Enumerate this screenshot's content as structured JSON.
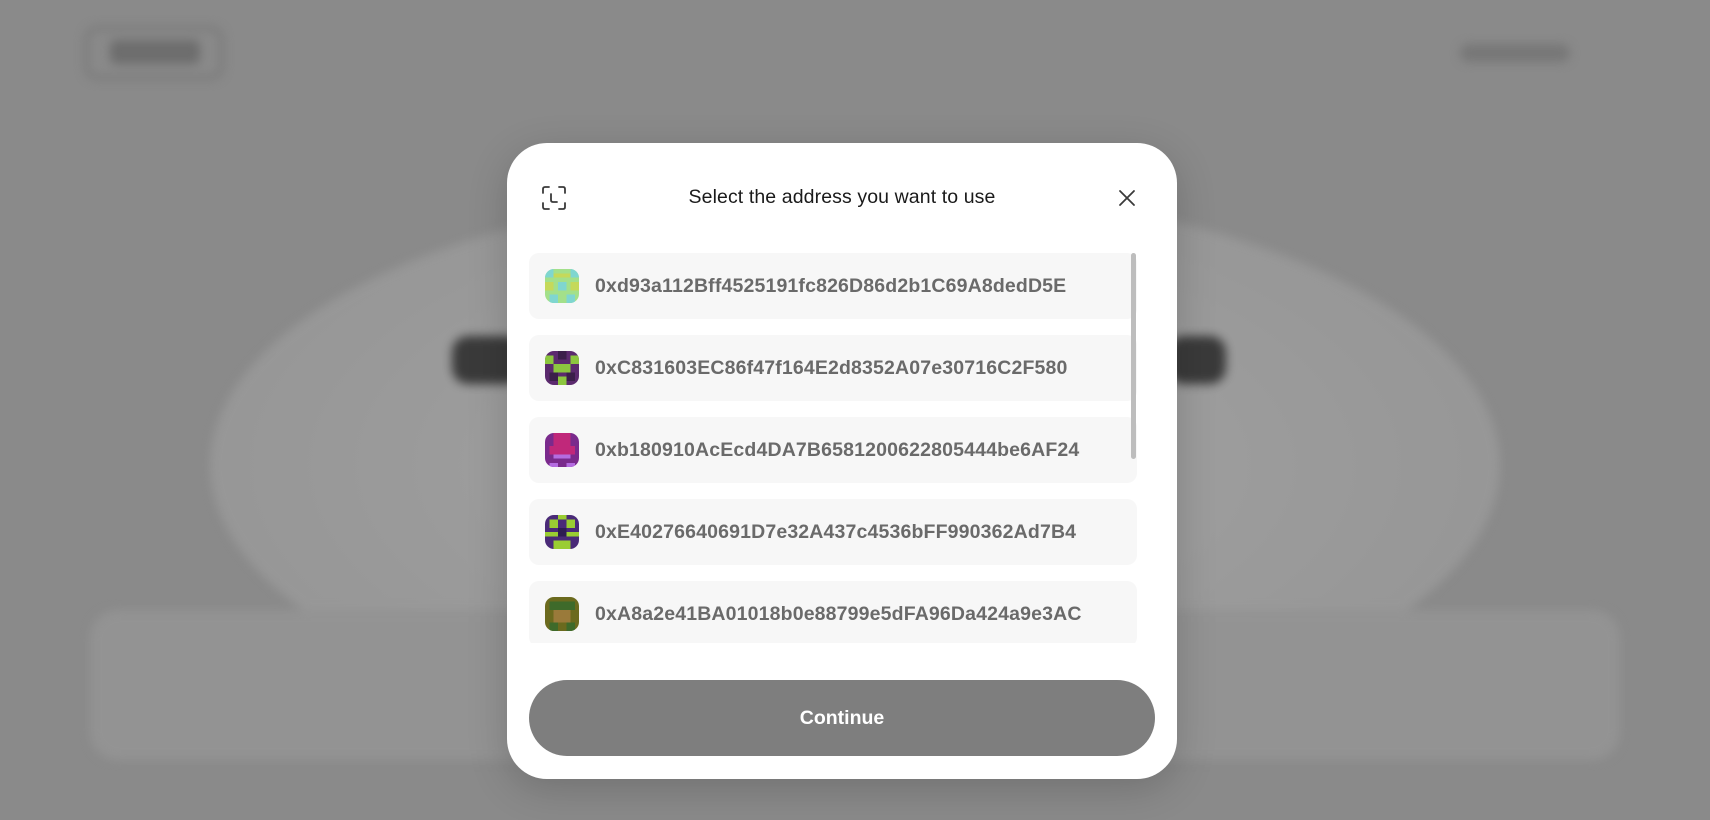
{
  "modal": {
    "title": "Select the address you want to use",
    "continue_label": "Continue",
    "icons": {
      "scan": "scan-qr-icon",
      "close": "close-icon"
    }
  },
  "addresses": [
    {
      "address": "0xd93a112Bff4525191fc826D86d2b1C69A8dedD5E",
      "avatar_colors": [
        "#7fd6d0",
        "#c5d95a",
        "#a3e08a"
      ]
    },
    {
      "address": "0xC831603EC86f47f164E2d8352A07e30716C2F580",
      "avatar_colors": [
        "#5b2a6e",
        "#8cc63f",
        "#3b1f4a"
      ]
    },
    {
      "address": "0xb180910AcEcd4DA7B6581200622805444be6AF24",
      "avatar_colors": [
        "#7a2a8c",
        "#c0287a",
        "#b46ce0"
      ]
    },
    {
      "address": "0xE40276640691D7e32A437c4536bFF990362Ad7B4",
      "avatar_colors": [
        "#4a2a78",
        "#9acd32",
        "#2e1c52"
      ]
    },
    {
      "address": "0xA8a2e41BA01018b0e88799e5dFA96Da424a9e3AC",
      "avatar_colors": [
        "#6b6a1e",
        "#9a7a3a",
        "#3e6a2a"
      ]
    }
  ]
}
